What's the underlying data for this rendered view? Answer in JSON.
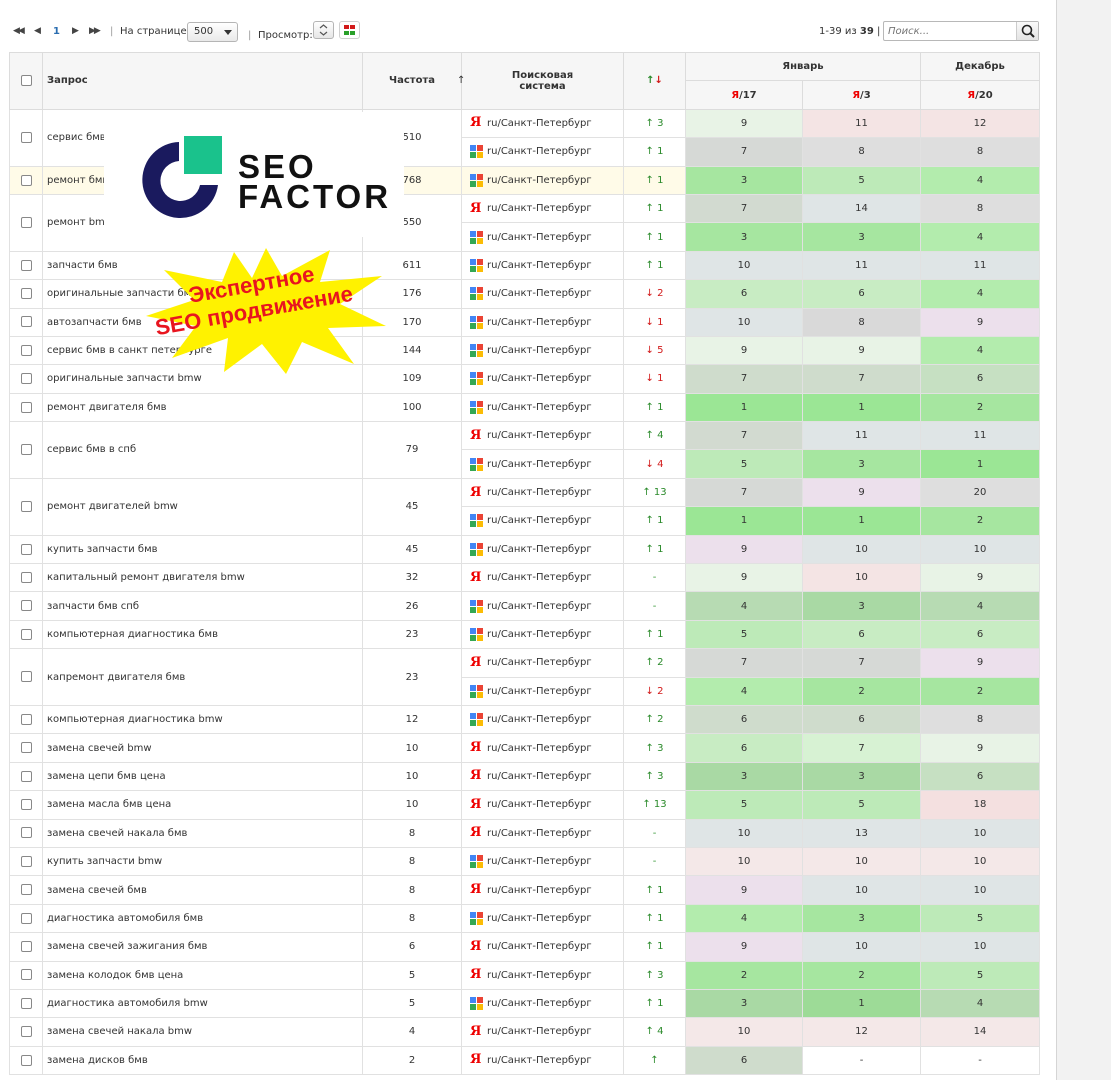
{
  "toolbar": {
    "pagination": {
      "first": "◀◀",
      "prev": "◀",
      "current_page": "1",
      "next": "▶",
      "last": "▶▶"
    },
    "per_page_label": "На странице:",
    "per_page_value": "500",
    "view_label": "Просмотр:",
    "range_text": "1-39 из",
    "total": "39",
    "search_placeholder": "Поиск..."
  },
  "columns": {
    "query": "Запрос",
    "frequency": "Частота",
    "frequency_sort": "↑",
    "search_engine": "Поисковая система",
    "change": "↑↓",
    "month1": "Январь",
    "month2": "Декабрь",
    "sub1_prefix": "Я",
    "sub1_suffix": "/17",
    "sub2_prefix": "Я",
    "sub2_suffix": "/3",
    "sub3_prefix": "Я",
    "sub3_suffix": "/20"
  },
  "overlay": {
    "logo_line1": "SEO",
    "logo_line2": "FACTOR",
    "star_line1": "Экспертное",
    "star_line2": "SEO продвижение"
  },
  "colors": {
    "green_strong": "#a6e6a0",
    "green": "#bdeab8",
    "green_light": "#d7f2d3",
    "green_pale": "#e8f3e6",
    "gray": "#dedede",
    "gray_blue": "#dfe5e6",
    "pink": "#f4e4e4",
    "lavender": "#ece0ec",
    "sage": "#cfdccc",
    "mid_green": "#b3d9b0"
  },
  "rows": [
    {
      "query": "сервис бмв",
      "freq": "510",
      "engines": [
        {
          "engine": "yandex",
          "region": "ru/Санкт-Петербург",
          "dir": "up",
          "delta": "3",
          "pos": [
            {
              "v": "9",
              "c": "#e8f3e6"
            },
            {
              "v": "11",
              "c": "#f4e4e4"
            },
            {
              "v": "12",
              "c": "#f4e4e4"
            }
          ]
        },
        {
          "engine": "google",
          "region": "ru/Санкт-Петербург",
          "dir": "up",
          "delta": "1",
          "pos": [
            {
              "v": "7",
              "c": "#d6d9d6"
            },
            {
              "v": "8",
              "c": "#dedede"
            },
            {
              "v": "8",
              "c": "#dedede"
            }
          ]
        }
      ]
    },
    {
      "query": "ремонт бмв",
      "freq": "768",
      "highlight": true,
      "engines": [
        {
          "engine": "google",
          "region": "ru/Санкт-Петербург",
          "dir": "up",
          "delta": "1",
          "pos": [
            {
              "v": "3",
              "c": "#a6e6a0"
            },
            {
              "v": "5",
              "c": "#bdeab8"
            },
            {
              "v": "4",
              "c": "#b3ecad"
            }
          ]
        }
      ]
    },
    {
      "query": "ремонт bmw",
      "freq": "550",
      "engines": [
        {
          "engine": "yandex",
          "region": "ru/Санкт-Петербург",
          "dir": "up",
          "delta": "1",
          "pos": [
            {
              "v": "7",
              "c": "#d2dad0"
            },
            {
              "v": "14",
              "c": "#dfe5e6"
            },
            {
              "v": "8",
              "c": "#dedede"
            }
          ]
        },
        {
          "engine": "google",
          "region": "ru/Санкт-Петербург",
          "dir": "up",
          "delta": "1",
          "pos": [
            {
              "v": "3",
              "c": "#a6e6a0"
            },
            {
              "v": "3",
              "c": "#a6e6a0"
            },
            {
              "v": "4",
              "c": "#b3ecad"
            }
          ]
        }
      ]
    },
    {
      "query": "запчасти бмв",
      "freq": "611",
      "engines": [
        {
          "engine": "google",
          "region": "ru/Санкт-Петербург",
          "dir": "up",
          "delta": "1",
          "pos": [
            {
              "v": "10",
              "c": "#dfe5e6"
            },
            {
              "v": "11",
              "c": "#dfe5e6"
            },
            {
              "v": "11",
              "c": "#dfe5e6"
            }
          ]
        }
      ]
    },
    {
      "query": "оригинальные запчасти бмв",
      "freq": "176",
      "engines": [
        {
          "engine": "google",
          "region": "ru/Санкт-Петербург",
          "dir": "down",
          "delta": "2",
          "pos": [
            {
              "v": "6",
              "c": "#c8ecc3"
            },
            {
              "v": "6",
              "c": "#c8ecc3"
            },
            {
              "v": "4",
              "c": "#b3ecad"
            }
          ]
        }
      ]
    },
    {
      "query": "автозапчасти бмв",
      "freq": "170",
      "engines": [
        {
          "engine": "google",
          "region": "ru/Санкт-Петербург",
          "dir": "down",
          "delta": "1",
          "pos": [
            {
              "v": "10",
              "c": "#dfe5e6"
            },
            {
              "v": "8",
              "c": "#d9d9d9"
            },
            {
              "v": "9",
              "c": "#ece0ec"
            }
          ]
        }
      ]
    },
    {
      "query": "сервис бмв в санкт петербурге",
      "freq": "144",
      "engines": [
        {
          "engine": "google",
          "region": "ru/Санкт-Петербург",
          "dir": "down",
          "delta": "5",
          "pos": [
            {
              "v": "9",
              "c": "#e8f3e6"
            },
            {
              "v": "9",
              "c": "#e8f3e6"
            },
            {
              "v": "4",
              "c": "#b3ecad"
            }
          ]
        }
      ]
    },
    {
      "query": "оригинальные запчасти bmw",
      "freq": "109",
      "engines": [
        {
          "engine": "google",
          "region": "ru/Санкт-Петербург",
          "dir": "down",
          "delta": "1",
          "pos": [
            {
              "v": "7",
              "c": "#cfdccc"
            },
            {
              "v": "7",
              "c": "#cfdccc"
            },
            {
              "v": "6",
              "c": "#c6e0c2"
            }
          ]
        }
      ]
    },
    {
      "query": "ремонт двигателя бмв",
      "freq": "100",
      "engines": [
        {
          "engine": "google",
          "region": "ru/Санкт-Петербург",
          "dir": "up",
          "delta": "1",
          "pos": [
            {
              "v": "1",
              "c": "#9be695"
            },
            {
              "v": "1",
              "c": "#9be695"
            },
            {
              "v": "2",
              "c": "#a6e6a0"
            }
          ]
        }
      ]
    },
    {
      "query": "сервис бмв в спб",
      "freq": "79",
      "engines": [
        {
          "engine": "yandex",
          "region": "ru/Санкт-Петербург",
          "dir": "up",
          "delta": "4",
          "pos": [
            {
              "v": "7",
              "c": "#d2dad0"
            },
            {
              "v": "11",
              "c": "#dfe5e6"
            },
            {
              "v": "11",
              "c": "#dfe5e6"
            }
          ]
        },
        {
          "engine": "google",
          "region": "ru/Санкт-Петербург",
          "dir": "down",
          "delta": "4",
          "pos": [
            {
              "v": "5",
              "c": "#bdeab8"
            },
            {
              "v": "3",
              "c": "#a6e6a0"
            },
            {
              "v": "1",
              "c": "#9be695"
            }
          ]
        }
      ]
    },
    {
      "query": "ремонт двигателей bmw",
      "freq": "45",
      "engines": [
        {
          "engine": "yandex",
          "region": "ru/Санкт-Петербург",
          "dir": "up",
          "delta": "13",
          "pos": [
            {
              "v": "7",
              "c": "#d6d9d6"
            },
            {
              "v": "9",
              "c": "#ece0ec"
            },
            {
              "v": "20",
              "c": "#dedede"
            }
          ]
        },
        {
          "engine": "google",
          "region": "ru/Санкт-Петербург",
          "dir": "up",
          "delta": "1",
          "pos": [
            {
              "v": "1",
              "c": "#9be695"
            },
            {
              "v": "1",
              "c": "#9be695"
            },
            {
              "v": "2",
              "c": "#a6e6a0"
            }
          ]
        }
      ]
    },
    {
      "query": "купить запчасти бмв",
      "freq": "45",
      "engines": [
        {
          "engine": "google",
          "region": "ru/Санкт-Петербург",
          "dir": "up",
          "delta": "1",
          "pos": [
            {
              "v": "9",
              "c": "#ece0ec"
            },
            {
              "v": "10",
              "c": "#dfe5e6"
            },
            {
              "v": "10",
              "c": "#dfe5e6"
            }
          ]
        }
      ]
    },
    {
      "query": "капитальный ремонт двигателя bmw",
      "freq": "32",
      "engines": [
        {
          "engine": "yandex",
          "region": "ru/Санкт-Петербург",
          "dir": "none",
          "delta": "-",
          "pos": [
            {
              "v": "9",
              "c": "#e8f3e6"
            },
            {
              "v": "10",
              "c": "#f4e4e4"
            },
            {
              "v": "9",
              "c": "#e8f3e6"
            }
          ]
        }
      ]
    },
    {
      "query": "запчасти бмв спб",
      "freq": "26",
      "engines": [
        {
          "engine": "google",
          "region": "ru/Санкт-Петербург",
          "dir": "none",
          "delta": "-",
          "pos": [
            {
              "v": "4",
              "c": "#b7dbb3"
            },
            {
              "v": "3",
              "c": "#a9d9a4"
            },
            {
              "v": "4",
              "c": "#b7dbb3"
            }
          ]
        }
      ]
    },
    {
      "query": "компьютерная диагностика бмв",
      "freq": "23",
      "engines": [
        {
          "engine": "google",
          "region": "ru/Санкт-Петербург",
          "dir": "up",
          "delta": "1",
          "pos": [
            {
              "v": "5",
              "c": "#bdeab8"
            },
            {
              "v": "6",
              "c": "#c8ecc3"
            },
            {
              "v": "6",
              "c": "#c8ecc3"
            }
          ]
        }
      ]
    },
    {
      "query": "капремонт двигателя бмв",
      "freq": "23",
      "engines": [
        {
          "engine": "yandex",
          "region": "ru/Санкт-Петербург",
          "dir": "up",
          "delta": "2",
          "pos": [
            {
              "v": "7",
              "c": "#d6d9d6"
            },
            {
              "v": "7",
              "c": "#d6d9d6"
            },
            {
              "v": "9",
              "c": "#ece0ec"
            }
          ]
        },
        {
          "engine": "google",
          "region": "ru/Санкт-Петербург",
          "dir": "down",
          "delta": "2",
          "pos": [
            {
              "v": "4",
              "c": "#b3ecad"
            },
            {
              "v": "2",
              "c": "#a6e6a0"
            },
            {
              "v": "2",
              "c": "#a6e6a0"
            }
          ]
        }
      ]
    },
    {
      "query": "компьютерная диагностика bmw",
      "freq": "12",
      "engines": [
        {
          "engine": "google",
          "region": "ru/Санкт-Петербург",
          "dir": "up",
          "delta": "2",
          "pos": [
            {
              "v": "6",
              "c": "#cfdccc"
            },
            {
              "v": "6",
              "c": "#cfdccc"
            },
            {
              "v": "8",
              "c": "#dedede"
            }
          ]
        }
      ]
    },
    {
      "query": "замена свечей bmw",
      "freq": "10",
      "engines": [
        {
          "engine": "yandex",
          "region": "ru/Санкт-Петербург",
          "dir": "up",
          "delta": "3",
          "pos": [
            {
              "v": "6",
              "c": "#c8ecc3"
            },
            {
              "v": "7",
              "c": "#d7f2d3"
            },
            {
              "v": "9",
              "c": "#e8f3e6"
            }
          ]
        }
      ]
    },
    {
      "query": "замена цепи бмв цена",
      "freq": "10",
      "engines": [
        {
          "engine": "yandex",
          "region": "ru/Санкт-Петербург",
          "dir": "up",
          "delta": "3",
          "pos": [
            {
              "v": "3",
              "c": "#a9d9a4"
            },
            {
              "v": "3",
              "c": "#a9d9a4"
            },
            {
              "v": "6",
              "c": "#c6e0c2"
            }
          ]
        }
      ]
    },
    {
      "query": "замена масла бмв цена",
      "freq": "10",
      "engines": [
        {
          "engine": "yandex",
          "region": "ru/Санкт-Петербург",
          "dir": "up",
          "delta": "13",
          "pos": [
            {
              "v": "5",
              "c": "#bdeab8"
            },
            {
              "v": "5",
              "c": "#bdeab8"
            },
            {
              "v": "18",
              "c": "#f4e0e0"
            }
          ]
        }
      ]
    },
    {
      "query": "замена свечей накала бмв",
      "freq": "8",
      "engines": [
        {
          "engine": "yandex",
          "region": "ru/Санкт-Петербург",
          "dir": "none",
          "delta": "-",
          "pos": [
            {
              "v": "10",
              "c": "#dfe5e6"
            },
            {
              "v": "13",
              "c": "#dfe5e6"
            },
            {
              "v": "10",
              "c": "#dfe5e6"
            }
          ]
        }
      ]
    },
    {
      "query": "купить запчасти bmw",
      "freq": "8",
      "engines": [
        {
          "engine": "google",
          "region": "ru/Санкт-Петербург",
          "dir": "none",
          "delta": "-",
          "pos": [
            {
              "v": "10",
              "c": "#f4e8e8"
            },
            {
              "v": "10",
              "c": "#f4e8e8"
            },
            {
              "v": "10",
              "c": "#f4e8e8"
            }
          ]
        }
      ]
    },
    {
      "query": "замена свечей бмв",
      "freq": "8",
      "engines": [
        {
          "engine": "yandex",
          "region": "ru/Санкт-Петербург",
          "dir": "up",
          "delta": "1",
          "pos": [
            {
              "v": "9",
              "c": "#ece0ec"
            },
            {
              "v": "10",
              "c": "#dfe5e6"
            },
            {
              "v": "10",
              "c": "#dfe5e6"
            }
          ]
        }
      ]
    },
    {
      "query": "диагностика автомобиля бмв",
      "freq": "8",
      "engines": [
        {
          "engine": "google",
          "region": "ru/Санкт-Петербург",
          "dir": "up",
          "delta": "1",
          "pos": [
            {
              "v": "4",
              "c": "#b3ecad"
            },
            {
              "v": "3",
              "c": "#a6e6a0"
            },
            {
              "v": "5",
              "c": "#bdeab8"
            }
          ]
        }
      ]
    },
    {
      "query": "замена свечей зажигания бмв",
      "freq": "6",
      "engines": [
        {
          "engine": "yandex",
          "region": "ru/Санкт-Петербург",
          "dir": "up",
          "delta": "1",
          "pos": [
            {
              "v": "9",
              "c": "#ece0ec"
            },
            {
              "v": "10",
              "c": "#dfe5e6"
            },
            {
              "v": "10",
              "c": "#dfe5e6"
            }
          ]
        }
      ]
    },
    {
      "query": "замена колодок бмв цена",
      "freq": "5",
      "engines": [
        {
          "engine": "yandex",
          "region": "ru/Санкт-Петербург",
          "dir": "up",
          "delta": "3",
          "pos": [
            {
              "v": "2",
              "c": "#a6e6a0"
            },
            {
              "v": "2",
              "c": "#a6e6a0"
            },
            {
              "v": "5",
              "c": "#bdeab8"
            }
          ]
        }
      ]
    },
    {
      "query": "диагностика автомобиля bmw",
      "freq": "5",
      "engines": [
        {
          "engine": "google",
          "region": "ru/Санкт-Петербург",
          "dir": "up",
          "delta": "1",
          "pos": [
            {
              "v": "3",
              "c": "#a9d9a4"
            },
            {
              "v": "1",
              "c": "#9ddb97"
            },
            {
              "v": "4",
              "c": "#b7dbb3"
            }
          ]
        }
      ]
    },
    {
      "query": "замена свечей накала bmw",
      "freq": "4",
      "engines": [
        {
          "engine": "yandex",
          "region": "ru/Санкт-Петербург",
          "dir": "up",
          "delta": "4",
          "pos": [
            {
              "v": "10",
              "c": "#f4e8e8"
            },
            {
              "v": "12",
              "c": "#f4e8e8"
            },
            {
              "v": "14",
              "c": "#f4e8e8"
            }
          ]
        }
      ]
    },
    {
      "query": "замена дисков бмв",
      "freq": "2",
      "engines": [
        {
          "engine": "yandex",
          "region": "ru/Санкт-Петербург",
          "dir": "up",
          "delta": "",
          "pos": [
            {
              "v": "6",
              "c": "#cfdccc"
            },
            {
              "v": "-",
              "c": "#ffffff"
            },
            {
              "v": "-",
              "c": "#ffffff"
            }
          ]
        }
      ]
    }
  ]
}
